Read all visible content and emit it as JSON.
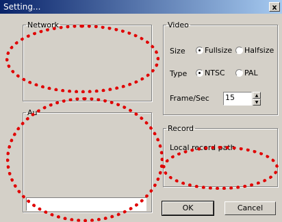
{
  "window": {
    "title": "Setting...",
    "close_label": "x"
  },
  "network": {
    "legend": "Network"
  },
  "audio": {
    "legend": "Au",
    "field_value": ""
  },
  "video": {
    "legend": "Video",
    "size_label": "Size",
    "size_options": [
      "Fullsize",
      "Halfsize"
    ],
    "size_selected": "Fullsize",
    "type_label": "Type",
    "type_options": [
      "NTSC",
      "PAL"
    ],
    "type_selected": "NTSC",
    "frame_label": "Frame/Sec",
    "frame_value": "15"
  },
  "record": {
    "legend": "Record",
    "path_label": "Local record path"
  },
  "buttons": {
    "ok": "OK",
    "cancel": "Cancel"
  },
  "colors": {
    "title_start": "#0a246a",
    "title_end": "#a6caf0",
    "redaction": "#e00000"
  }
}
